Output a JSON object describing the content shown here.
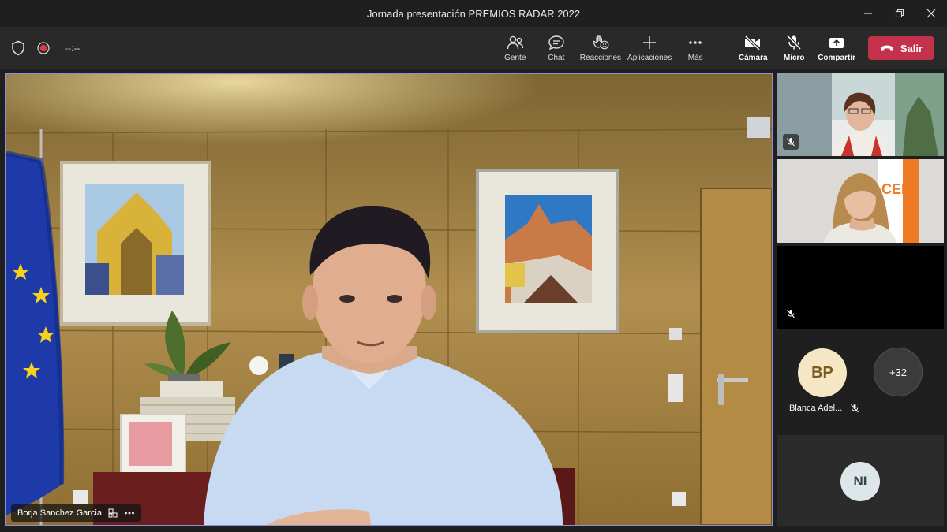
{
  "window": {
    "title": "Jornada presentación PREMIOS RADAR 2022"
  },
  "toolbar": {
    "timer": "--:--",
    "buttons": [
      {
        "label": "Gente",
        "icon": "people-icon"
      },
      {
        "label": "Chat",
        "icon": "chat-icon"
      },
      {
        "label": "Reacciones",
        "icon": "reactions-icon"
      },
      {
        "label": "Aplicaciones",
        "icon": "apps-icon"
      },
      {
        "label": "Más",
        "icon": "more-icon"
      }
    ],
    "camera_label": "Cámara",
    "mic_label": "Micro",
    "share_label": "Compartir",
    "leave_label": "Salir",
    "leave_color": "#c4314b"
  },
  "main_video": {
    "speaker_name": "Borja Sanchez Garcia"
  },
  "participants": [
    {
      "type": "video",
      "muted": true
    },
    {
      "type": "video",
      "muted": false
    },
    {
      "type": "video-off",
      "muted": true
    },
    {
      "type": "avatar",
      "initials": "BP",
      "name": "Blanca Adel...",
      "muted": true
    },
    {
      "type": "overflow",
      "label": "+32"
    },
    {
      "type": "avatar",
      "initials": "NI"
    }
  ],
  "colors": {
    "accent": "#8d90d8",
    "bp_avatar_bg": "#f5e6c4",
    "bp_avatar_fg": "#7a5a1e",
    "ni_avatar_bg": "#dfe6ea",
    "ni_avatar_fg": "#2f4450"
  }
}
